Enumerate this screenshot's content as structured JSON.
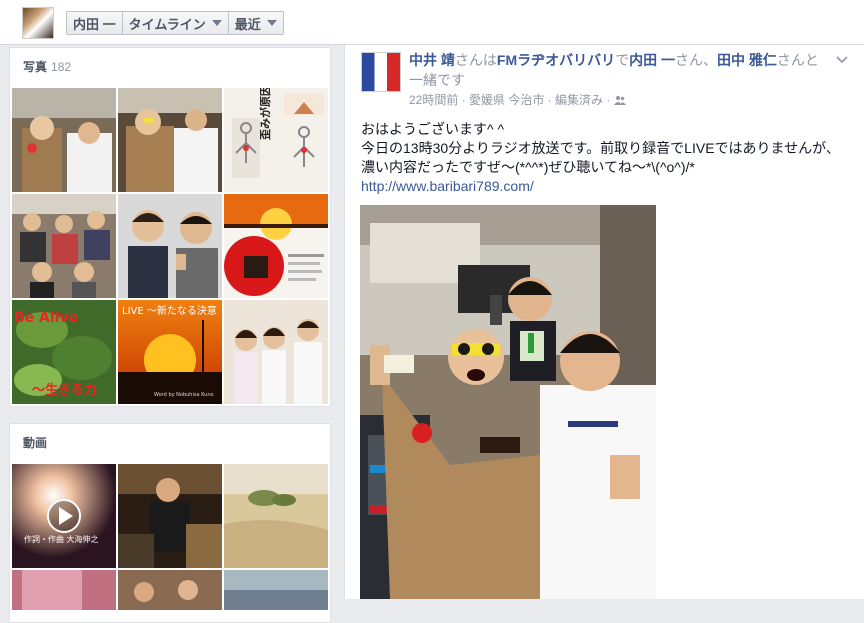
{
  "header": {
    "crumbs": [
      {
        "label": "内田 一"
      },
      {
        "label": "タイムライン"
      },
      {
        "label": "最近"
      }
    ]
  },
  "photos": {
    "title": "写真",
    "count": "182",
    "tiles": [
      {
        "caption": ""
      },
      {
        "caption": ""
      },
      {
        "caption": "歪みが原因!"
      },
      {
        "caption": ""
      },
      {
        "caption": ""
      },
      {
        "caption": ""
      },
      {
        "caption": "Be Alive ～生きる力"
      },
      {
        "caption": "LIVE ～新たなる決意"
      },
      {
        "caption": ""
      }
    ],
    "tile8_subcaption": "Word by Nobuhisa Kuno"
  },
  "videos": {
    "title": "動画",
    "video1_caption": "作詞・作曲 大海伸之"
  },
  "post": {
    "author": "中井 靖",
    "text1": "さんは",
    "place": "FMラヂオバリバリ",
    "text2": "で",
    "with1": "内田 一",
    "text3": "さん、",
    "with2": "田中 雅仁",
    "text4": "さんと一緒です",
    "meta": "22時間前 · 愛媛県 今治市 · 編集済み ·",
    "line1": "おはようございます^ ^",
    "line2": "今日の13時30分よりラジオ放送です。前取り録音でLIVEではありませんが、濃い内容だったですぜ～(*^^*)ぜひ聴いてね～*\\(^o^)/*",
    "url": "http://www.baribari789.com/"
  },
  "colors": {
    "link": "#3b5998",
    "bg": "#e9ebee"
  }
}
